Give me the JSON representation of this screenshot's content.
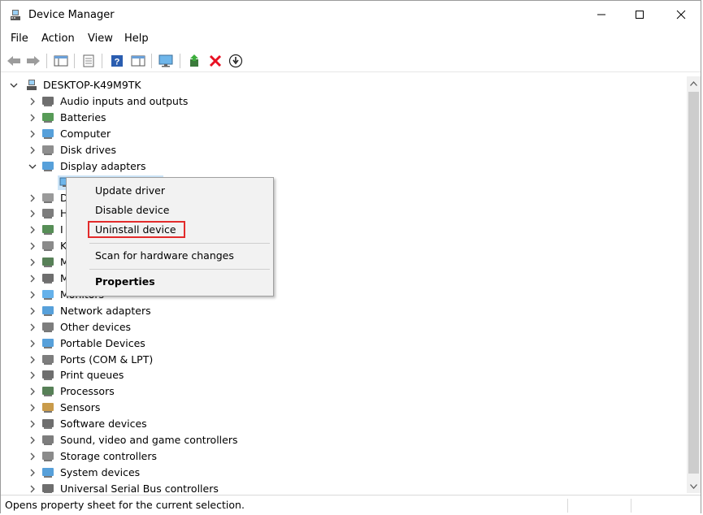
{
  "window": {
    "title": "Device Manager",
    "controls": {
      "minimize": "—",
      "maximize": "☐",
      "close": "✕"
    }
  },
  "menubar": [
    "File",
    "Action",
    "View",
    "Help"
  ],
  "toolbar": {
    "buttons": [
      "back-arrow",
      "forward-arrow",
      "show-hide-console-tree",
      "properties-sheet",
      "help",
      "action-pane",
      "monitor-display",
      "update-driver",
      "uninstall-device",
      "scan-hardware-changes"
    ]
  },
  "tree": {
    "root": "DESKTOP-K49M9TK",
    "categories": [
      {
        "label": "Audio inputs and outputs",
        "icon": "speaker-icon"
      },
      {
        "label": "Batteries",
        "icon": "battery-icon"
      },
      {
        "label": "Computer",
        "icon": "computer-icon"
      },
      {
        "label": "Disk drives",
        "icon": "disk-drive-icon"
      },
      {
        "label": "Display adapters",
        "icon": "display-adapter-icon",
        "expanded": true
      },
      {
        "label": "D",
        "icon": "dvd-drive-icon"
      },
      {
        "label": "H",
        "icon": "hid-icon"
      },
      {
        "label": "I",
        "icon": "ide-controller-icon"
      },
      {
        "label": "K",
        "icon": "keyboard-icon"
      },
      {
        "label": "M",
        "icon": "memory-device-icon"
      },
      {
        "label": "M",
        "icon": "mouse-icon"
      },
      {
        "label": "Monitors",
        "icon": "monitor-icon"
      },
      {
        "label": "Network adapters",
        "icon": "network-adapter-icon"
      },
      {
        "label": "Other devices",
        "icon": "other-devices-icon"
      },
      {
        "label": "Portable Devices",
        "icon": "portable-device-icon"
      },
      {
        "label": "Ports (COM & LPT)",
        "icon": "ports-icon"
      },
      {
        "label": "Print queues",
        "icon": "printer-icon"
      },
      {
        "label": "Processors",
        "icon": "processor-icon"
      },
      {
        "label": "Sensors",
        "icon": "sensor-icon"
      },
      {
        "label": "Software devices",
        "icon": "software-device-icon"
      },
      {
        "label": "Sound, video and game controllers",
        "icon": "sound-icon"
      },
      {
        "label": "Storage controllers",
        "icon": "storage-controller-icon"
      },
      {
        "label": "System devices",
        "icon": "system-device-icon"
      },
      {
        "label": "Universal Serial Bus controllers",
        "icon": "usb-icon"
      }
    ]
  },
  "context_menu": {
    "items": [
      "Update driver",
      "Disable device",
      "Uninstall device",
      "Scan for hardware changes",
      "Properties"
    ],
    "highlighted": "Uninstall device"
  },
  "status": {
    "text": "Opens property sheet for the current selection."
  },
  "colors": {
    "selection": "#cce4f7",
    "highlight_box": "#e32b2b",
    "uninstall_x": "#e81123"
  }
}
